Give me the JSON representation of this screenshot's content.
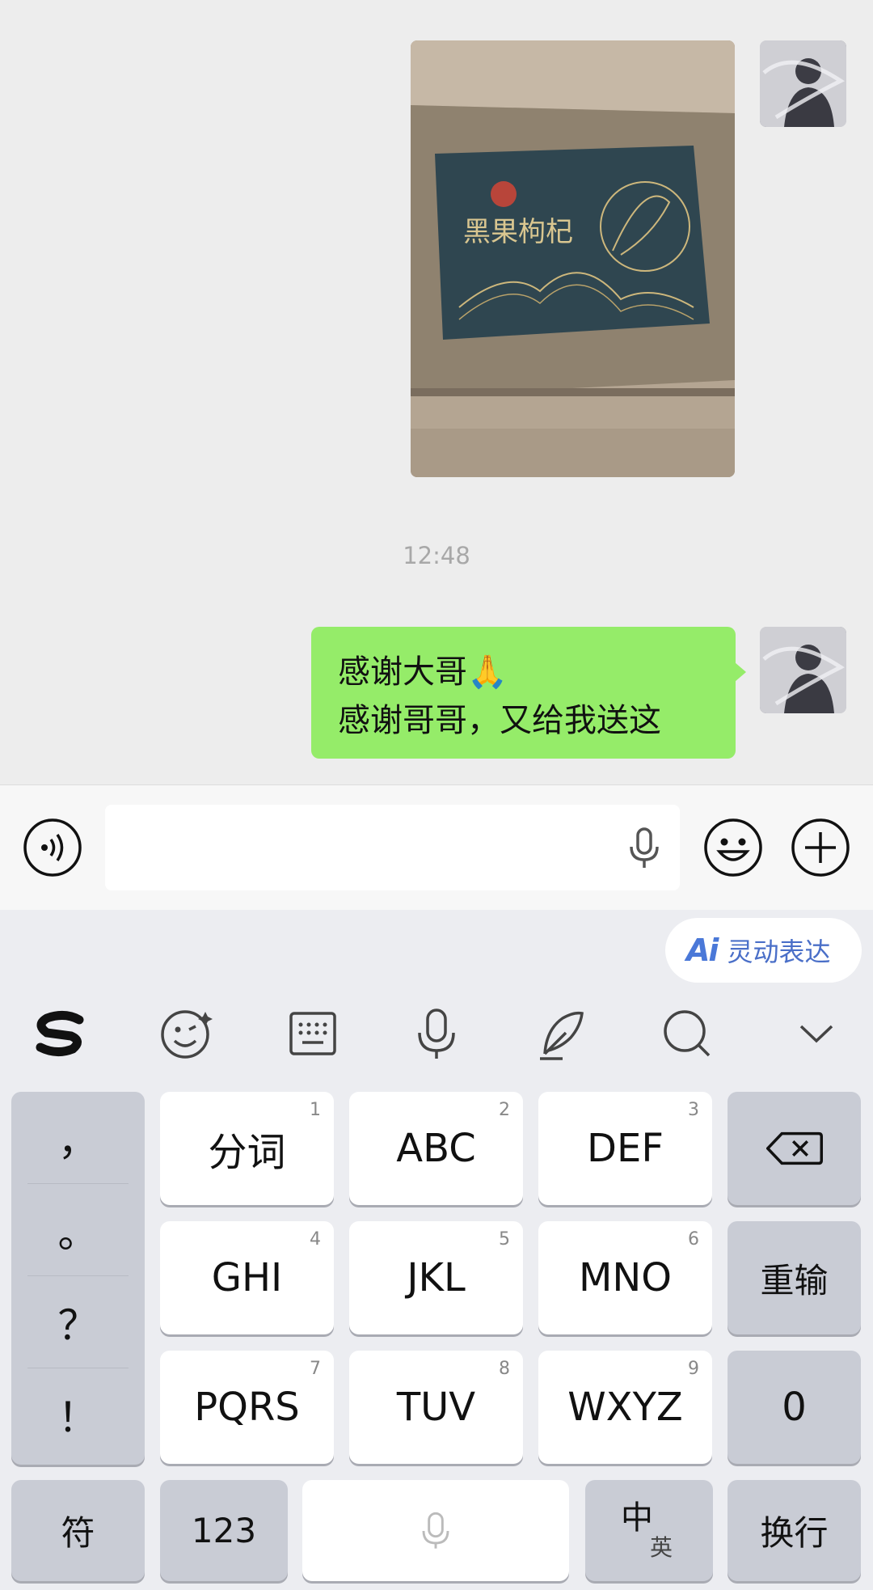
{
  "chat": {
    "messages": [
      {
        "type": "image",
        "sender": "self",
        "product_text": "黑果枸杞"
      },
      {
        "type": "timestamp",
        "text": "12:48"
      },
      {
        "type": "text",
        "sender": "self",
        "lines": [
          "感谢大哥🙏",
          "感谢哥哥，又给我送这"
        ]
      }
    ]
  },
  "input_bar": {
    "placeholder": "",
    "icons": [
      "voice-icon",
      "mic-icon",
      "emoji-icon",
      "plus-icon"
    ]
  },
  "keyboard": {
    "ai_button": {
      "logo": "Ai",
      "label": "灵动表达"
    },
    "toolbar": [
      "sogou-logo",
      "smile-icon",
      "keyboard-icon",
      "mic-icon",
      "pen-icon",
      "search-icon",
      "chevron-down-icon"
    ],
    "punctuation": [
      "，",
      "。",
      "？",
      "！"
    ],
    "keys": [
      {
        "label": "分词",
        "num": "1"
      },
      {
        "label": "ABC",
        "num": "2"
      },
      {
        "label": "DEF",
        "num": "3"
      },
      {
        "label": "GHI",
        "num": "4"
      },
      {
        "label": "JKL",
        "num": "5"
      },
      {
        "label": "MNO",
        "num": "6"
      },
      {
        "label": "PQRS",
        "num": "7"
      },
      {
        "label": "TUV",
        "num": "8"
      },
      {
        "label": "WXYZ",
        "num": "9"
      }
    ],
    "side_keys": {
      "delete": "backspace-icon",
      "reinput": "重输",
      "zero": "0"
    },
    "bottom_row": {
      "symbols": "符",
      "numbers": "123",
      "space": "mic-icon",
      "lang_main": "中",
      "lang_sub": "英",
      "enter": "换行"
    }
  },
  "colors": {
    "bubble": "#95ec69",
    "chat_bg": "#ededed",
    "ai_blue": "#4a78d8"
  }
}
